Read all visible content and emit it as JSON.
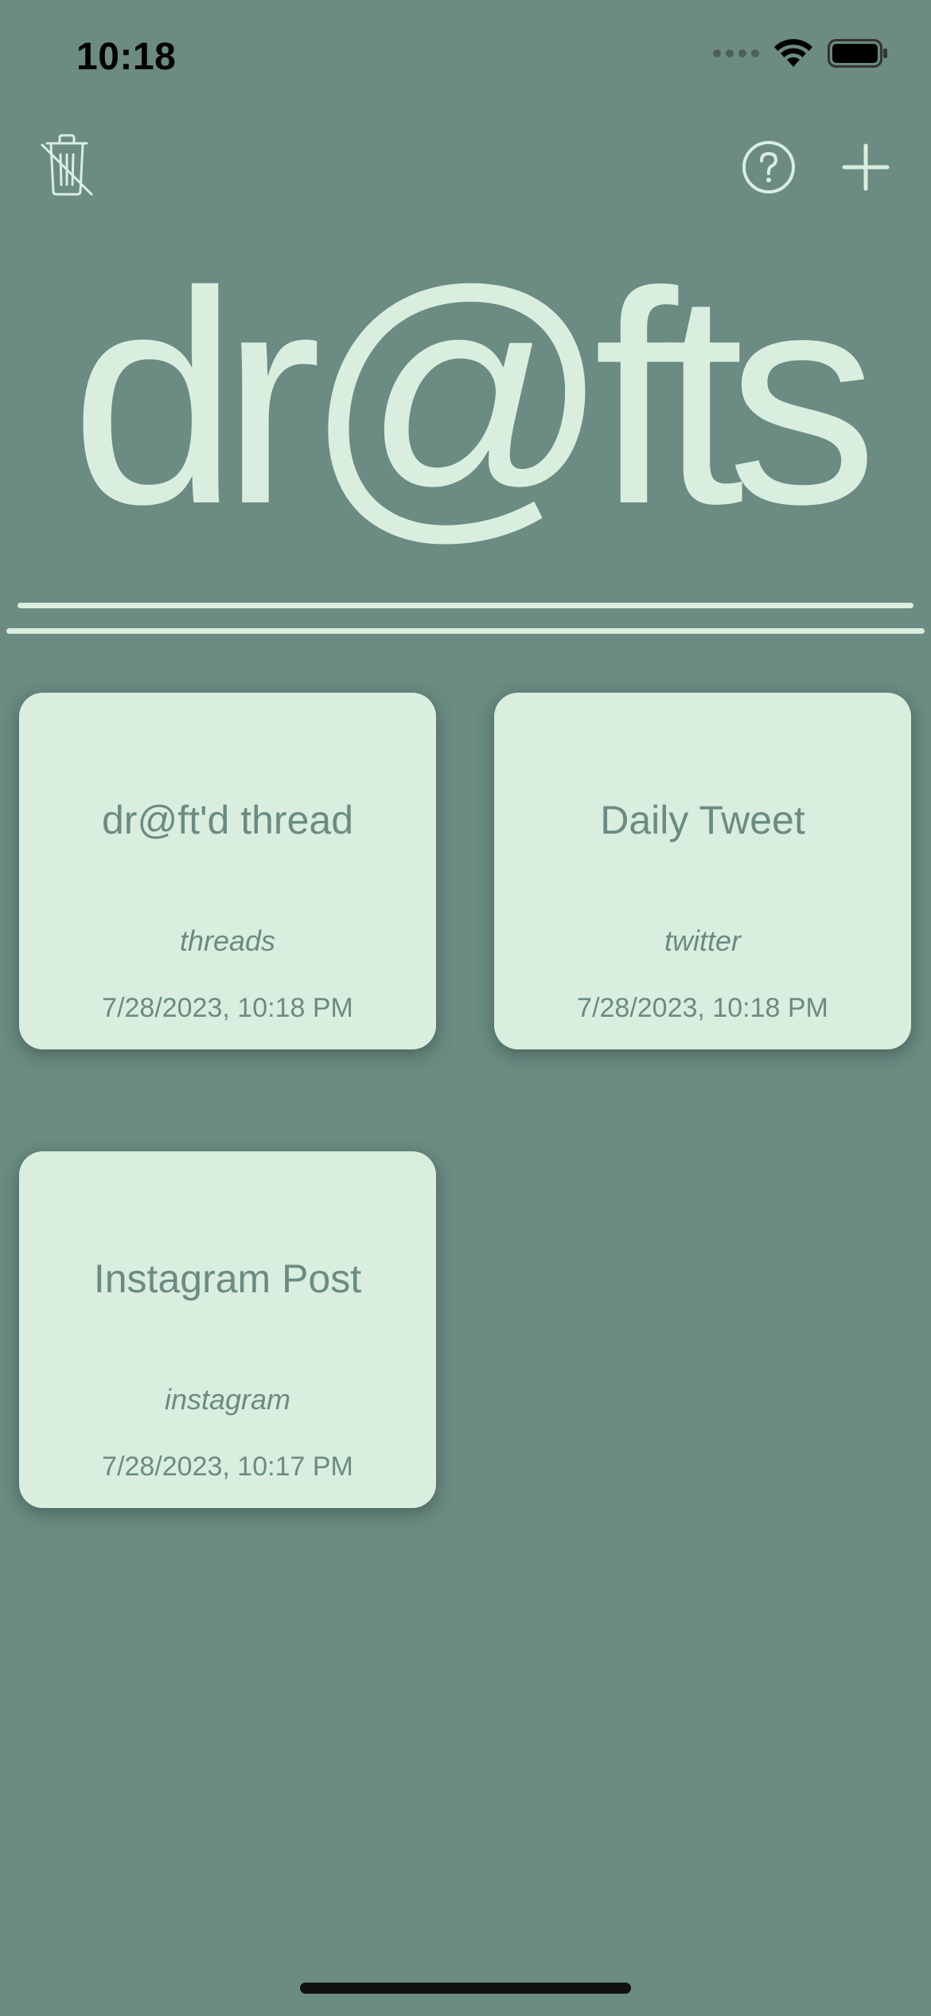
{
  "status_bar": {
    "time": "10:18"
  },
  "toolbar": {
    "trash_icon": "trash-slash-icon",
    "help_icon": "question-circle-icon",
    "add_icon": "plus-icon"
  },
  "logo": {
    "text": "dr@fts"
  },
  "colors": {
    "background": "#6b8b83",
    "card": "#daeee0",
    "accent": "#daeee0"
  },
  "drafts": [
    {
      "title": "dr@ft'd thread",
      "platform": "threads",
      "date": "7/28/2023, 10:18 PM"
    },
    {
      "title": "Daily Tweet",
      "platform": "twitter",
      "date": "7/28/2023, 10:18 PM"
    },
    {
      "title": "Instagram Post",
      "platform": "instagram",
      "date": "7/28/2023, 10:17 PM"
    }
  ]
}
